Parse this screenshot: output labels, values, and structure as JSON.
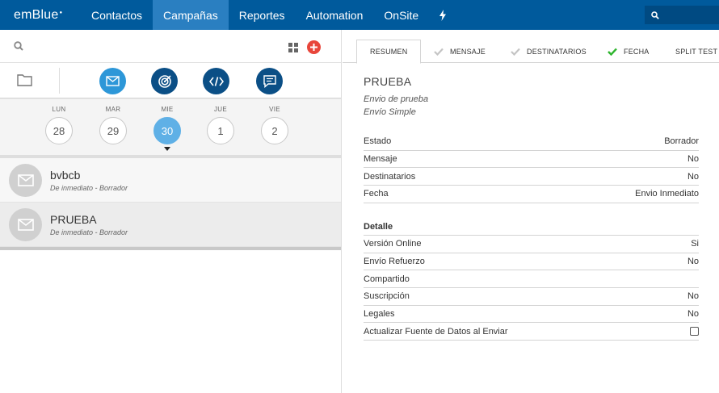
{
  "topbar": {
    "logo": "emBlue",
    "nav": [
      "Contactos",
      "Campañas",
      "Reportes",
      "Automation",
      "OnSite"
    ],
    "active_nav": "Campañas"
  },
  "calendar": {
    "days": [
      {
        "label": "LUN",
        "num": "28"
      },
      {
        "label": "MAR",
        "num": "29"
      },
      {
        "label": "MIE",
        "num": "30"
      },
      {
        "label": "JUE",
        "num": "1"
      },
      {
        "label": "VIE",
        "num": "2"
      }
    ],
    "active_index": 2
  },
  "campaigns": [
    {
      "name": "bvbcb",
      "sub": "De inmediato - Borrador"
    },
    {
      "name": "PRUEBA",
      "sub": "De inmediato - Borrador"
    }
  ],
  "tabs": {
    "resumen": "RESUMEN",
    "mensaje": "MENSAJE",
    "destinatarios": "DESTINATARIOS",
    "fecha": "FECHA",
    "split": "SPLIT TEST"
  },
  "summary": {
    "title": "PRUEBA",
    "subtitle1": "Envio de prueba",
    "subtitle2": "Envío Simple",
    "rows": [
      {
        "label": "Estado",
        "value": "Borrador"
      },
      {
        "label": "Mensaje",
        "value": "No"
      },
      {
        "label": "Destinatarios",
        "value": "No"
      },
      {
        "label": "Fecha",
        "value": "Envio Inmediato"
      }
    ],
    "detalle_title": "Detalle",
    "detalle": [
      {
        "label": "Versión Online",
        "value": "Si"
      },
      {
        "label": "Envío Refuerzo",
        "value": "No"
      },
      {
        "label": "Compartido",
        "value": ""
      },
      {
        "label": "Suscripción",
        "value": "No"
      },
      {
        "label": "Legales",
        "value": "No"
      }
    ],
    "update_label": "Actualizar Fuente de Datos al Enviar"
  },
  "colors": {
    "nav_bg": "#005a9c",
    "nav_active": "#2a7fc1",
    "accent": "#2d97d8",
    "check_green": "#2fb52f"
  }
}
